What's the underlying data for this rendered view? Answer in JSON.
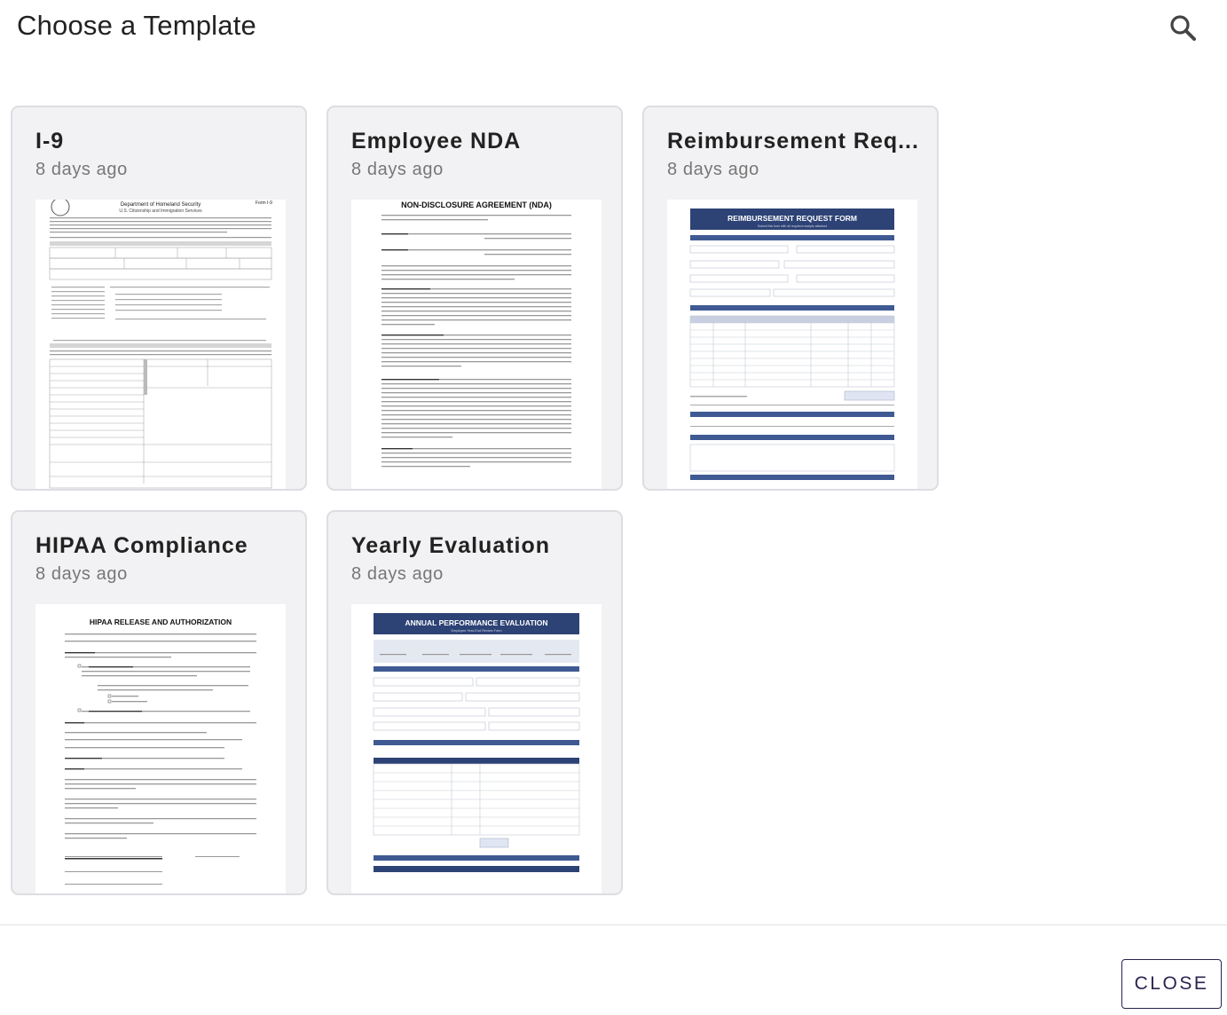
{
  "header": {
    "title": "Choose a Template",
    "search_icon": "search-icon"
  },
  "templates": [
    {
      "title": "I-9",
      "date": "8 days ago",
      "preview": {
        "heading": "Department of Homeland Security",
        "subheading": "U.S. Citizenship and Immigration Services",
        "form_id": "Form I-9"
      }
    },
    {
      "title": "Employee NDA",
      "date": "8 days ago",
      "preview": {
        "heading": "NON-DISCLOSURE AGREEMENT (NDA)"
      }
    },
    {
      "title": "Reimbursement Req...",
      "date": "8 days ago",
      "preview": {
        "heading": "REIMBURSEMENT REQUEST FORM",
        "subheading": "Submit this form with all required receipts attached"
      }
    },
    {
      "title": "HIPAA Compliance",
      "date": "8 days ago",
      "preview": {
        "heading": "HIPAA RELEASE AND AUTHORIZATION"
      }
    },
    {
      "title": "Yearly Evaluation",
      "date": "8 days ago",
      "preview": {
        "heading": "ANNUAL PERFORMANCE EVALUATION",
        "subheading": "Employee Year-End Review Form"
      }
    }
  ],
  "footer": {
    "close_label": "CLOSE"
  },
  "colors": {
    "accent": "#2b2350",
    "card_bg": "#f2f2f4",
    "card_border": "#dddde2",
    "form_header_blue": "#2d4275"
  }
}
